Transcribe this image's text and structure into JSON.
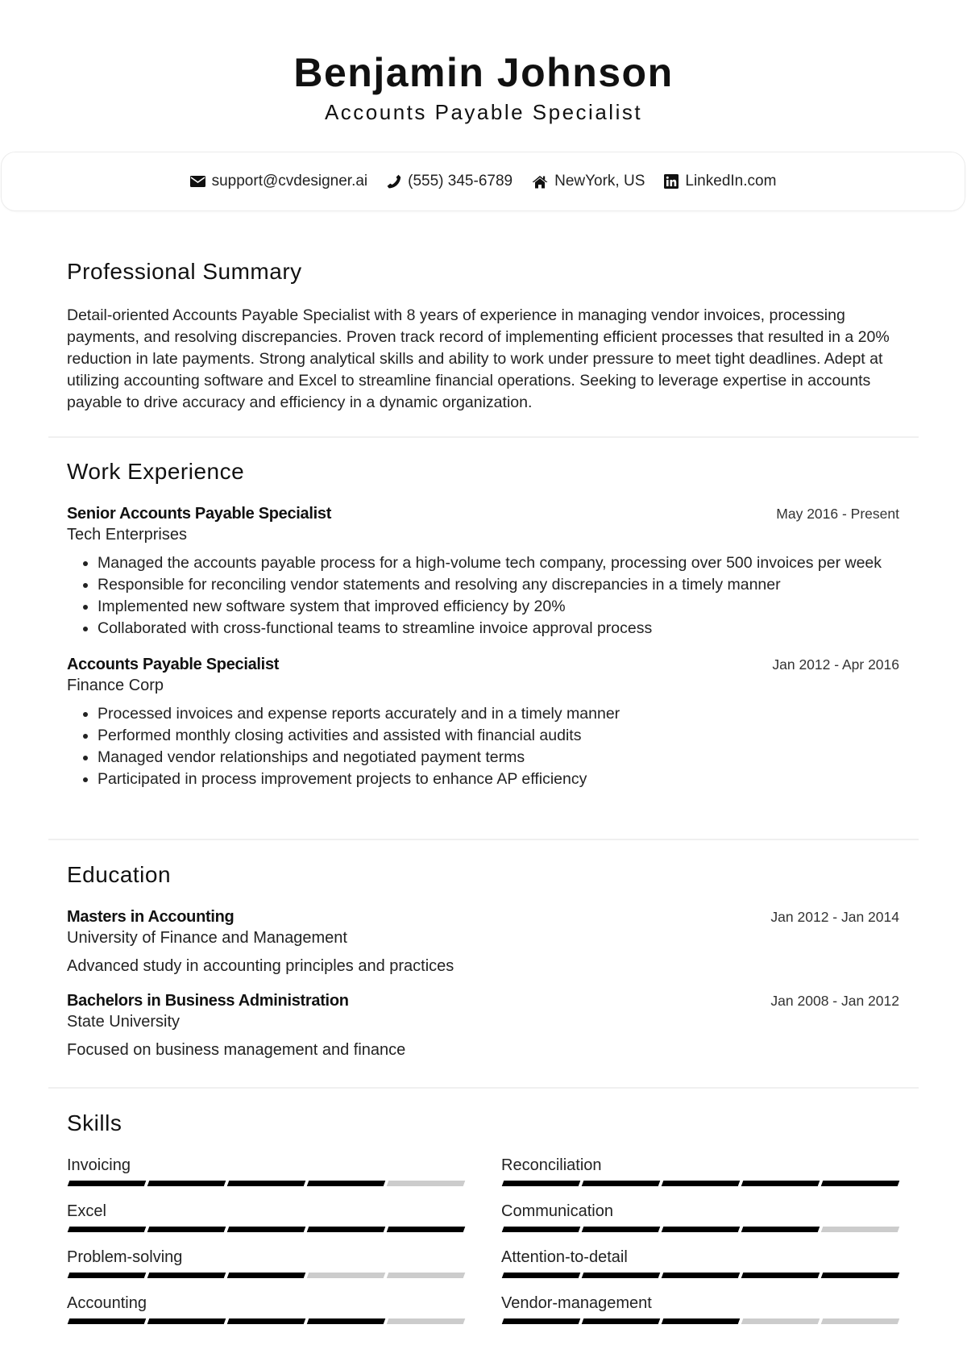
{
  "header": {
    "name": "Benjamin Johnson",
    "title": "Accounts Payable Specialist"
  },
  "contact": [
    {
      "icon": "envelope-icon",
      "text": "support@cvdesigner.ai"
    },
    {
      "icon": "phone-icon",
      "text": "(555) 345-6789"
    },
    {
      "icon": "home-icon",
      "text": "NewYork, US"
    },
    {
      "icon": "linkedin-icon",
      "text": "LinkedIn.com"
    }
  ],
  "summary": {
    "heading": "Professional Summary",
    "text": "Detail-oriented Accounts Payable Specialist with 8 years of experience in managing vendor invoices, processing payments, and resolving discrepancies. Proven track record of implementing efficient processes that resulted in a 20% reduction in late payments. Strong analytical skills and ability to work under pressure to meet tight deadlines. Adept at utilizing accounting software and Excel to streamline financial operations. Seeking to leverage expertise in accounts payable to drive accuracy and efficiency in a dynamic organization."
  },
  "experience": {
    "heading": "Work Experience",
    "jobs": [
      {
        "title": "Senior Accounts Payable Specialist",
        "company": "Tech Enterprises",
        "dates": "May 2016 - Present",
        "bullets": [
          "Managed the accounts payable process for a high-volume tech company, processing over 500 invoices per week",
          "Responsible for reconciling vendor statements and resolving any discrepancies in a timely manner",
          "Implemented new software system that improved efficiency by 20%",
          "Collaborated with cross-functional teams to streamline invoice approval process"
        ]
      },
      {
        "title": "Accounts Payable Specialist",
        "company": "Finance Corp",
        "dates": "Jan 2012 - Apr 2016",
        "bullets": [
          "Processed invoices and expense reports accurately and in a timely manner",
          "Performed monthly closing activities and assisted with financial audits",
          "Managed vendor relationships and negotiated payment terms",
          "Participated in process improvement projects to enhance AP efficiency"
        ]
      }
    ]
  },
  "education": {
    "heading": "Education",
    "items": [
      {
        "degree": "Masters in Accounting",
        "school": "University of Finance and Management",
        "dates": "Jan 2012 - Jan 2014",
        "description": "Advanced study in accounting principles and practices"
      },
      {
        "degree": "Bachelors in Business Administration",
        "school": "State University",
        "dates": "Jan 2008 - Jan 2012",
        "description": "Focused on business management and finance"
      }
    ]
  },
  "skills": {
    "heading": "Skills",
    "max_level": 5,
    "items": [
      {
        "name": "Invoicing",
        "level": 4
      },
      {
        "name": "Reconciliation",
        "level": 5
      },
      {
        "name": "Excel",
        "level": 5
      },
      {
        "name": "Communication",
        "level": 4
      },
      {
        "name": "Problem-solving",
        "level": 3
      },
      {
        "name": "Attention-to-detail",
        "level": 5
      },
      {
        "name": "Accounting",
        "level": 4
      },
      {
        "name": "Vendor-management",
        "level": 3
      }
    ]
  }
}
